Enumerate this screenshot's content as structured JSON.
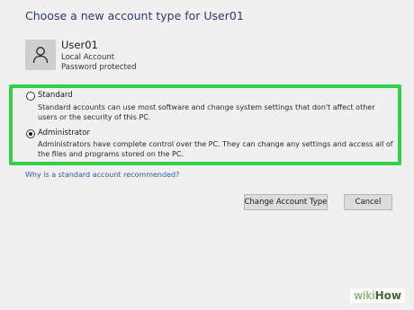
{
  "page": {
    "title": "Choose a new account type for User01"
  },
  "user": {
    "name": "User01",
    "account_kind": "Local Account",
    "protection": "Password protected",
    "avatar_icon": "person-icon"
  },
  "options": [
    {
      "label": "Standard",
      "description": "Standard accounts can use most software and change system settings that don't affect other users or the security of this PC.",
      "selected": false
    },
    {
      "label": "Administrator",
      "description": "Administrators have complete control over the PC. They can change any settings and access all of the files and programs stored on the PC.",
      "selected": true
    }
  ],
  "help_link": "Why is a standard account recommended?",
  "buttons": {
    "change": "Change Account Type",
    "cancel": "Cancel"
  },
  "watermark": {
    "part1": "wiki",
    "part2": "How"
  },
  "colors": {
    "highlight": "#34d049",
    "title": "#2d3a6a",
    "link": "#2a5cae",
    "background": "#f0f0f0"
  }
}
